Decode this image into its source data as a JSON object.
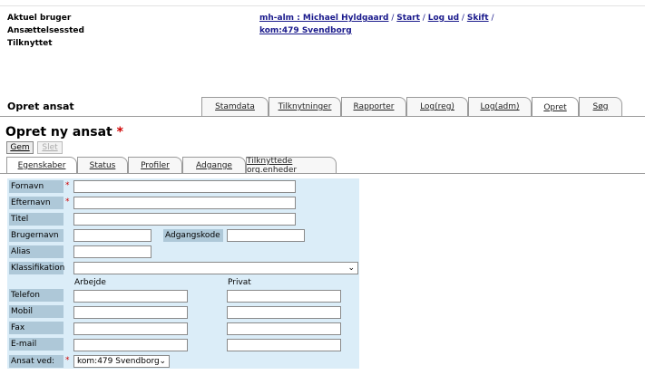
{
  "header": {
    "label_user": "Aktuel bruger",
    "label_employment": "Ansættelsessted",
    "label_attached": "Tilknyttet",
    "user_link": "mh-alm : Michael Hyldgaard",
    "sep": "/",
    "start": "Start",
    "logout": "Log ud",
    "switch": "Skift",
    "employment_link": "kom:479 Svendborg"
  },
  "section_title": "Opret ansat",
  "tabs": [
    "Stamdata",
    "Tilknytninger",
    "Rapporter",
    "Log(reg)",
    "Log(adm)",
    "Opret",
    "Søg"
  ],
  "page_title": "Opret ny ansat",
  "required_star": "*",
  "buttons": {
    "save": "Gem",
    "delete": "Slet"
  },
  "subtabs": [
    "Egenskaber",
    "Status",
    "Profiler",
    "Adgange",
    "Tilknyttede org.enheder"
  ],
  "form": {
    "firstname": "Fornavn",
    "lastname": "Efternavn",
    "title": "Titel",
    "username": "Brugernavn",
    "password": "Adgangskode",
    "alias": "Alias",
    "classification": "Klassifikation",
    "col_work": "Arbejde",
    "col_private": "Privat",
    "phone": "Telefon",
    "mobile": "Mobil",
    "fax": "Fax",
    "email": "E-mail",
    "employed_at": "Ansat ved:",
    "employed_value": "kom:479 Svendborg",
    "classification_value": ""
  }
}
